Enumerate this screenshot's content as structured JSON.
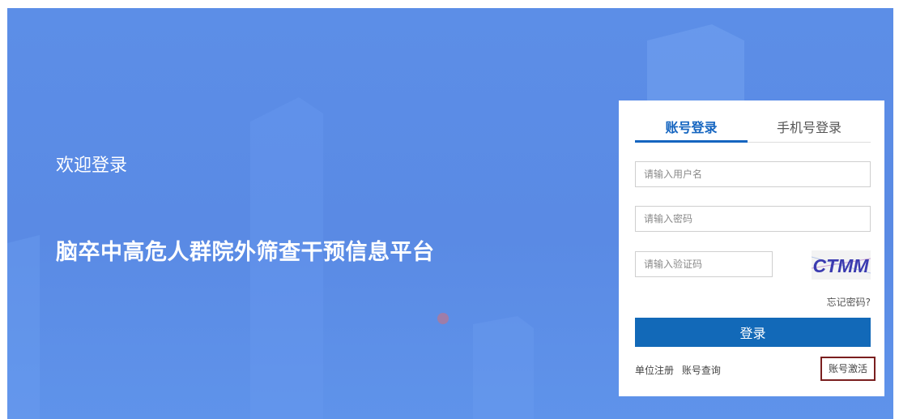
{
  "hero": {
    "welcome": "欢迎登录",
    "platform_title": "脑卒中高危人群院外筛查干预信息平台"
  },
  "login": {
    "tabs": [
      {
        "label": "账号登录",
        "active": true
      },
      {
        "label": "手机号登录",
        "active": false
      }
    ],
    "username_placeholder": "请输入用户名",
    "password_placeholder": "请输入密码",
    "captcha_placeholder": "请输入验证码",
    "captcha_text": "CTMM",
    "forgot_label": "忘记密码?",
    "submit_label": "登录",
    "register_label": "单位注册",
    "account_query_label": "账号查询",
    "activate_label": "账号激活"
  },
  "colors": {
    "background": "#5c8ee7",
    "primary": "#1269b8",
    "highlight_border": "#7a1f1f"
  }
}
